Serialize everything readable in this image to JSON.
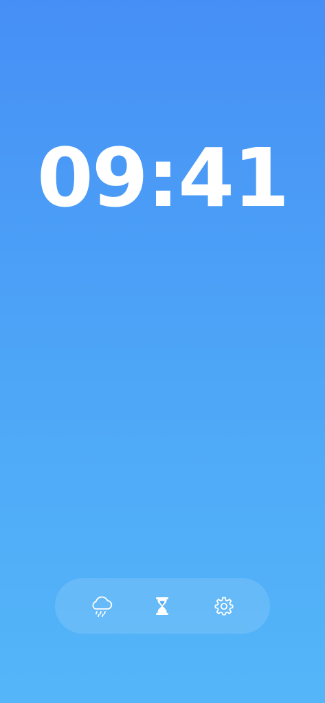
{
  "clock": {
    "time": "09:41"
  },
  "colors": {
    "gradient_top": "#468ff6",
    "gradient_bottom": "#54b6f9",
    "foreground": "#ffffff"
  },
  "dock": {
    "items": [
      {
        "icon": "cloud-rain-icon"
      },
      {
        "icon": "hourglass-icon"
      },
      {
        "icon": "gear-icon"
      }
    ]
  }
}
